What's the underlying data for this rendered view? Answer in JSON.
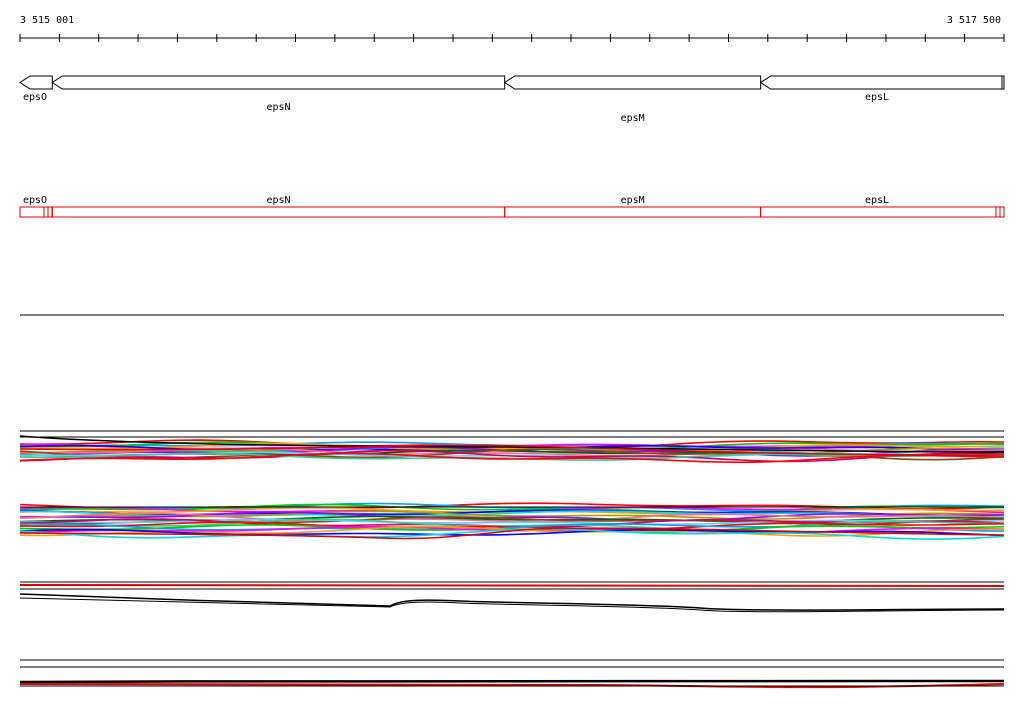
{
  "coordinates": {
    "start": "3 515 001",
    "end": "3 517 500",
    "start_value": 3515001,
    "end_value": 3517500
  },
  "genes": [
    {
      "name": "epsO",
      "start": 3515001,
      "end": 3515083,
      "strand": "-"
    },
    {
      "name": "epsN",
      "start": 3515083,
      "end": 3516232,
      "strand": "-"
    },
    {
      "name": "epsM",
      "start": 3516232,
      "end": 3516882,
      "strand": "-"
    },
    {
      "name": "epsL",
      "start": 3516882,
      "end": 3517500,
      "strand": "-"
    }
  ],
  "feature_track": {
    "color": "#e00000",
    "labels": [
      "epsO",
      "epsN",
      "epsM",
      "epsL"
    ]
  },
  "colors": {
    "ruler": "#000000",
    "gene_outline": "#000000",
    "feature": "#e00000",
    "profile_palette": [
      "#ff0000",
      "#00a0ff",
      "#00cc00",
      "#ff00ff",
      "#ffa000",
      "#0000ff",
      "#00dddd",
      "#a0a000",
      "#9900ff",
      "#ff6699",
      "#006600",
      "#8b4513",
      "#66ccff",
      "#cc0066",
      "#33cc99"
    ]
  }
}
